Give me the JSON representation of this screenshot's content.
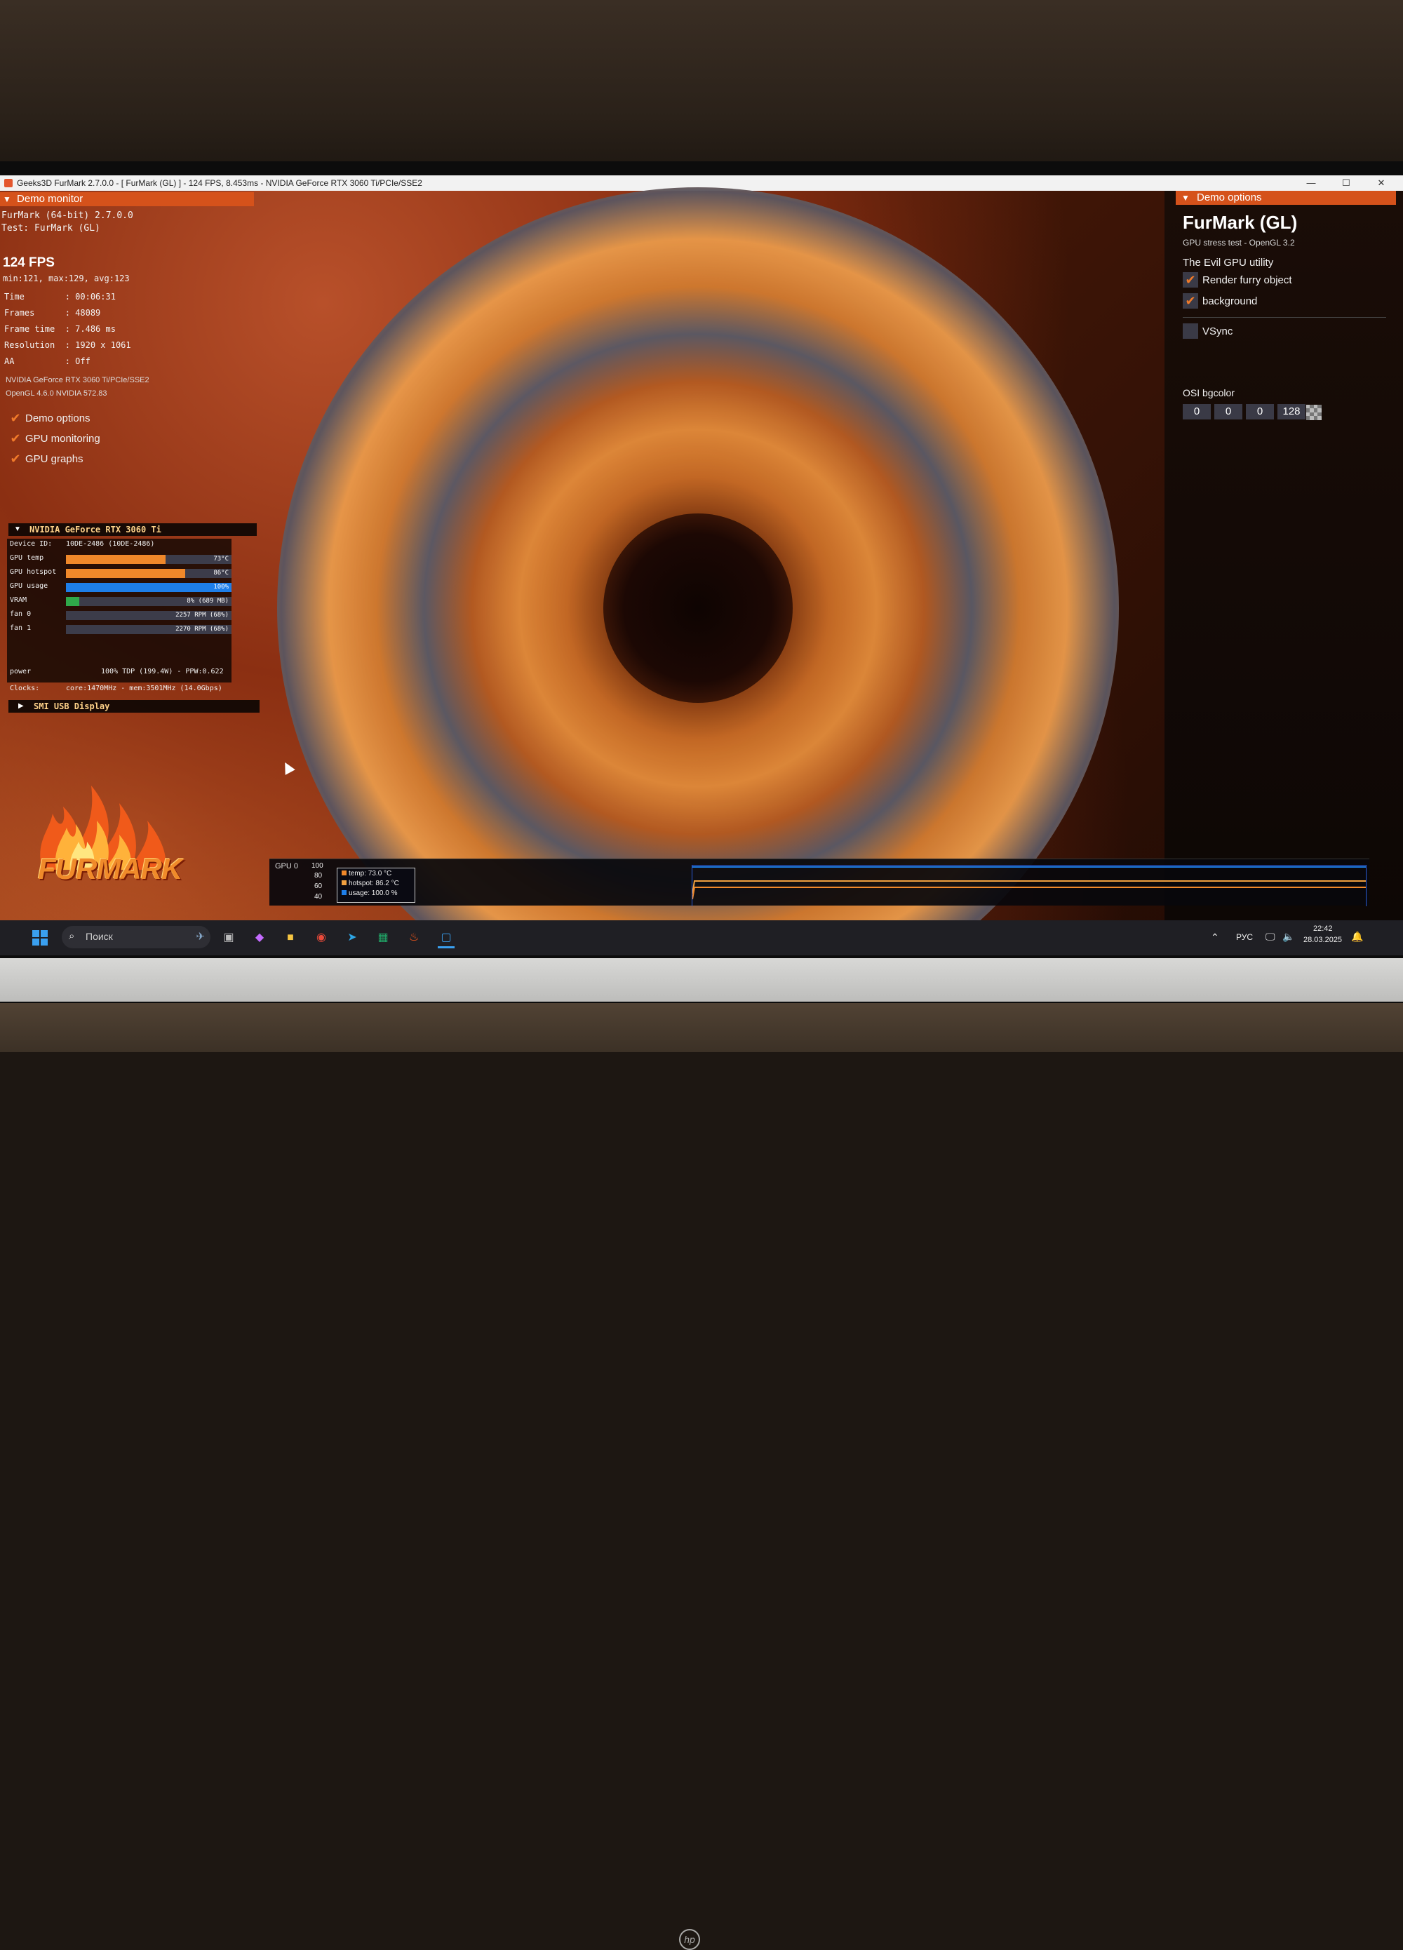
{
  "window": {
    "title": "Geeks3D FurMark 2.7.0.0 - [ FurMark (GL) ] - 124 FPS, 8.453ms - NVIDIA GeForce RTX 3060 Ti/PCIe/SSE2",
    "minimize": "—",
    "maximize": "☐",
    "close": "✕"
  },
  "demo_monitor": {
    "header": "Demo monitor",
    "app_line": "FurMark (64-bit) 2.7.0.0",
    "test_line": "Test: FurMark (GL)",
    "fps": "124 FPS",
    "fps_stats": "min:121, max:129, avg:123",
    "stats": [
      "Time        : 00:06:31",
      "Frames      : 48089",
      "Frame time  : 7.486 ms",
      "Resolution  : 1920 x 1061",
      "AA          : Off"
    ],
    "gpu_name": "NVIDIA GeForce RTX 3060 Ti/PCIe/SSE2",
    "opengl": "OpenGL 4.6.0 NVIDIA 572.83",
    "checks": [
      {
        "label": "Demo options",
        "checked": true
      },
      {
        "label": "GPU monitoring",
        "checked": true
      },
      {
        "label": "GPU graphs",
        "checked": true
      }
    ]
  },
  "gpu_monitor": {
    "header": "NVIDIA GeForce RTX 3060 Ti",
    "device_id_label": "Device ID:",
    "device_id": "10DE-2486 (10DE-2486)",
    "rows": [
      {
        "label": "GPU temp",
        "value": "73°C",
        "fraction": 0.6,
        "color": "#f0882a"
      },
      {
        "label": "GPU hotspot",
        "value": "86°C",
        "fraction": 0.72,
        "color": "#f0882a"
      },
      {
        "label": "GPU usage",
        "value": "100%",
        "fraction": 1.0,
        "color": "#1e7ee8"
      },
      {
        "label": "VRAM",
        "value": "8% (689 MB)",
        "fraction": 0.08,
        "color": "#2fa84a"
      },
      {
        "label": "fan 0",
        "value": "2257 RPM (68%)",
        "fraction": 0.0,
        "color": "#5a5a6a"
      },
      {
        "label": "fan 1",
        "value": "2270 RPM (68%)",
        "fraction": 0.0,
        "color": "#5a5a6a"
      }
    ],
    "power_label": "power",
    "power": "100% TDP (199.4W) - PPW:0.622",
    "clocks_label": "Clocks:",
    "clocks": "core:1470MHz - mem:3501MHz (14.0Gbps)"
  },
  "smi": {
    "header": "SMI USB Display"
  },
  "logo": {
    "text": "FURMARK"
  },
  "demo_options": {
    "header": "Demo options",
    "title": "FurMark (GL)",
    "subtitle": "GPU stress test - OpenGL 3.2",
    "section": "The Evil GPU utility",
    "checks": [
      {
        "label": "Render furry object",
        "checked": true
      },
      {
        "label": "background",
        "checked": true
      }
    ],
    "vsync_label": "VSync",
    "vsync_checked": false,
    "bgcolor_label": "OSI bgcolor",
    "bgcolor": [
      "0",
      "0",
      "0",
      "128"
    ]
  },
  "gpu_graph": {
    "label": "GPU 0",
    "yticks": [
      "100",
      "80",
      "60",
      "40"
    ],
    "legend": [
      {
        "label": "temp: 73.0 °C",
        "color": "#f0882a"
      },
      {
        "label": "hotspot: 86.2 °C",
        "color": "#f0a040"
      },
      {
        "label": "usage: 100.0 %",
        "color": "#1e7ee8"
      }
    ]
  },
  "taskbar": {
    "search_placeholder": "Поиск",
    "lang": "РУС",
    "time": "22:42",
    "date": "28.03.2025"
  }
}
